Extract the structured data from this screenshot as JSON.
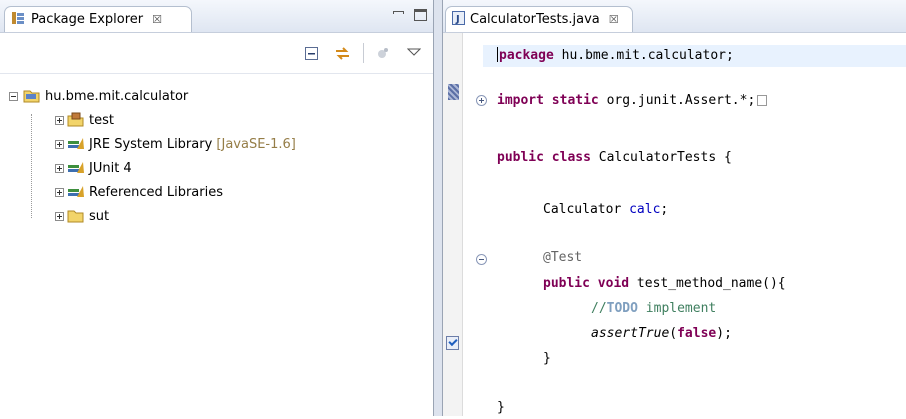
{
  "package_explorer": {
    "tab_title": "Package Explorer",
    "tab_close": "☒",
    "tree": [
      {
        "label": "hu.bme.mit.calculator",
        "expanded": true,
        "icon": "project-folder-icon"
      },
      {
        "label": "test",
        "icon": "source-folder-icon"
      },
      {
        "label": "JRE System Library",
        "decoration": "[JavaSE-1.6]",
        "icon": "library-icon"
      },
      {
        "label": "JUnit 4",
        "icon": "library-icon"
      },
      {
        "label": "Referenced Libraries",
        "icon": "library-icon"
      },
      {
        "label": "sut",
        "icon": "folder-icon"
      }
    ]
  },
  "editor": {
    "tab_title": "CalculatorTests.java",
    "tab_close": "☒",
    "code": {
      "pkg_kw": "package",
      "pkg_rest": " hu.bme.mit.calculator;",
      "import_kw": "import static",
      "import_rest": " org.junit.Assert.*;",
      "class_kw": "public class",
      "class_rest": " CalculatorTests {",
      "field_type": "Calculator ",
      "field_name": "calc",
      "field_end": ";",
      "annotation": "@Test",
      "method_kw": "public void",
      "method_rest": " test_method_name(){",
      "comment_prefix": "//",
      "comment_todo": "TODO",
      "comment_rest": " implement",
      "assert_call": "assertTrue",
      "assert_open": "(",
      "assert_arg": "false",
      "assert_close": ");",
      "method_close": "}",
      "class_close": "}"
    }
  },
  "colors": {
    "keyword": "#7f0055",
    "annotation": "#646464",
    "field": "#0000c0",
    "comment": "#3f7f5f",
    "todo": "#7f9fbf",
    "current_line": "#e8f2fe"
  }
}
